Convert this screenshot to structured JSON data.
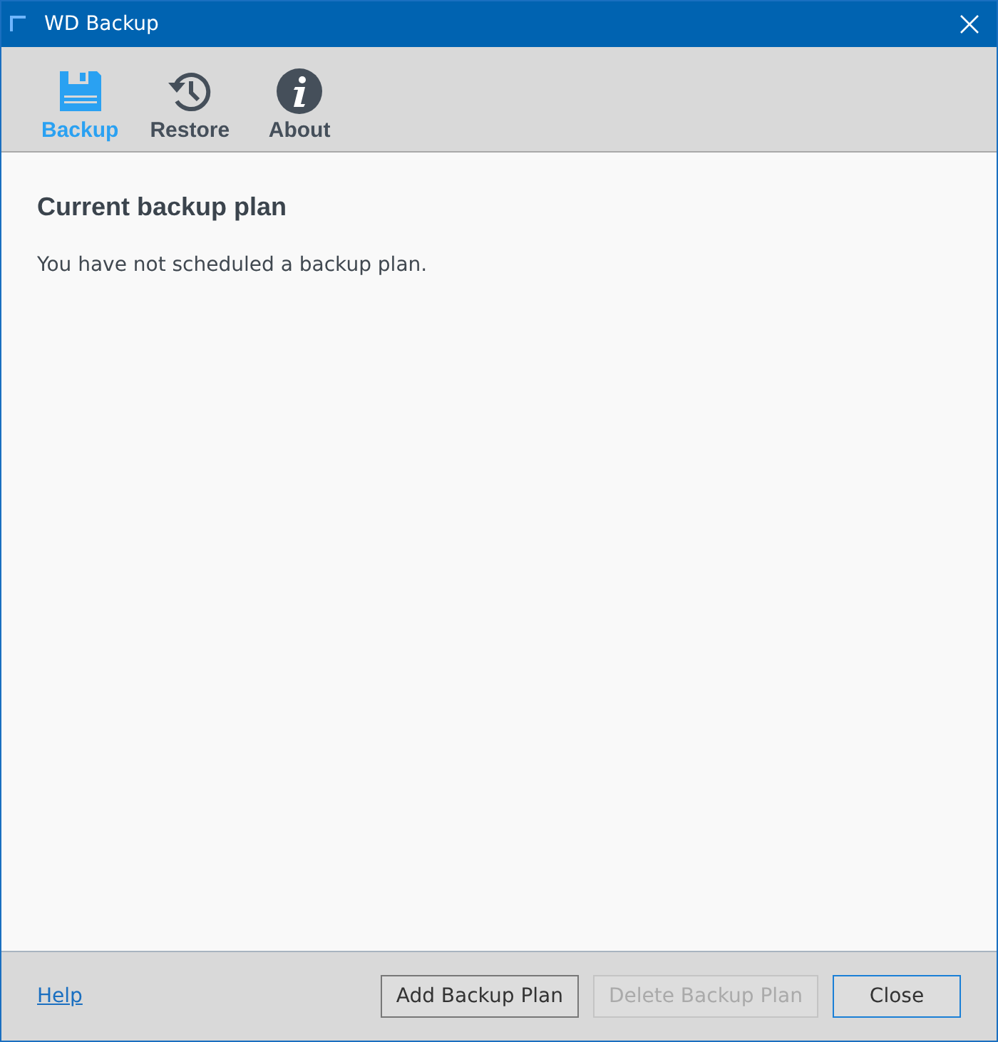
{
  "window": {
    "title": "WD Backup"
  },
  "tabs": [
    {
      "label": "Backup",
      "kind": "backup",
      "selected": true
    },
    {
      "label": "Restore",
      "kind": "restore",
      "selected": false
    },
    {
      "label": "About",
      "kind": "about",
      "selected": false
    }
  ],
  "content": {
    "heading": "Current backup plan",
    "message": "You have not scheduled a backup plan."
  },
  "footer": {
    "link": "Help",
    "buttons": [
      {
        "label": "Add Backup Plan",
        "disabled": false,
        "focused": false
      },
      {
        "label": "Delete Backup Plan",
        "disabled": true,
        "focused": false
      },
      {
        "label": "Close",
        "disabled": false,
        "focused": true
      }
    ]
  }
}
